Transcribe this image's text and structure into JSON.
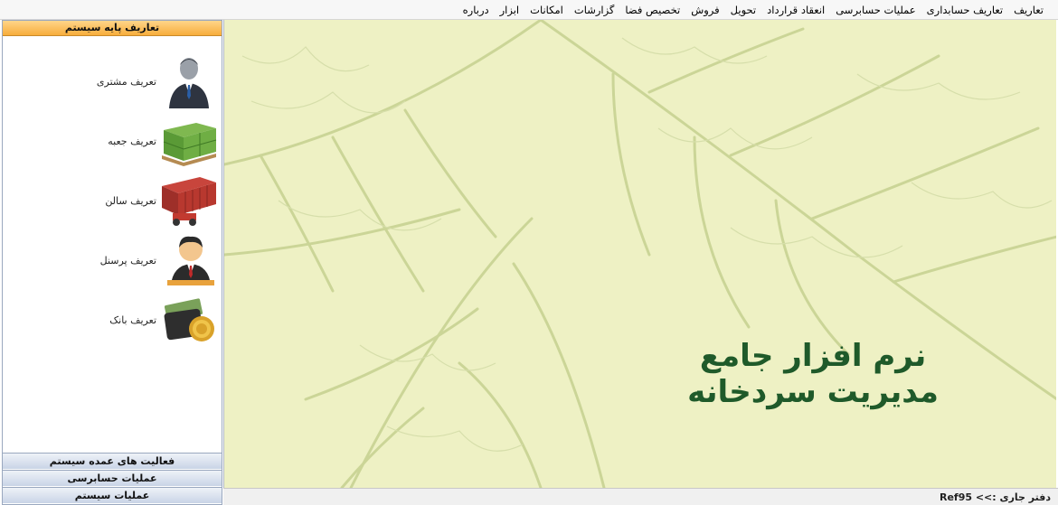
{
  "menu": {
    "items": [
      "تعاریف",
      "تعاریف حسابداری",
      "عملیات حسابرسی",
      "انعقاد قرارداد",
      "تحویل",
      "فروش",
      "تخصیص فضا",
      "گزارشات",
      "امکانات",
      "ابزار",
      "درباره"
    ]
  },
  "sidebar": {
    "header": "تعاریف پایه سیستم",
    "items": [
      {
        "label": "تعریف مشتری",
        "icon": "customer-icon"
      },
      {
        "label": "تعریف جعبه",
        "icon": "box-pallet-icon"
      },
      {
        "label": "تعریف سالن",
        "icon": "container-forklift-icon"
      },
      {
        "label": "تعریف پرسنل",
        "icon": "personnel-icon"
      },
      {
        "label": "تعریف بانک",
        "icon": "wallet-coin-icon"
      }
    ],
    "bottom_buttons": [
      "فعالیت های عمده سیستم",
      "عملیات حسابرسی",
      "عملیات سیستم"
    ]
  },
  "main": {
    "brand_line1": "نرم افزار جامع",
    "brand_line2": "مدیریت سردخانه"
  },
  "status": {
    "text": "دفتر جاری :>> Ref95"
  },
  "colors": {
    "background": "#eef1c4",
    "leaf_vein": "#c9d39a",
    "brand": "#1f5a2a",
    "header_orange": "#f7ad3c"
  }
}
